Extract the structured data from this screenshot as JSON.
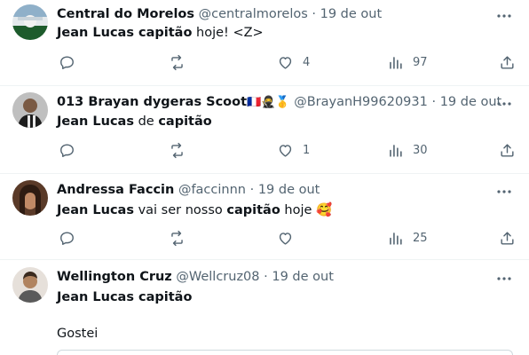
{
  "tweets": [
    {
      "name": "Central do Morelos",
      "handle": "@centralmorelos",
      "dot": "·",
      "date": "19 de out",
      "text_parts": [
        {
          "t": "Jean Lucas ",
          "b": true
        },
        {
          "t": "capitão",
          "b": true
        },
        {
          "t": " hoje! <Z>",
          "b": false
        }
      ],
      "counts": {
        "reply": "",
        "retweet": "",
        "like": "4",
        "views": "97"
      },
      "avatar_colors": [
        "#1d5b2c",
        "#d8dde0"
      ]
    },
    {
      "name": "013 Brayan dygeras Scoot",
      "name_emojis": "🇫🇷🥷🥇",
      "handle": "@BrayanH99620931",
      "dot": "·",
      "date": "19 de out",
      "text_parts": [
        {
          "t": "Jean Lucas",
          "b": true
        },
        {
          "t": " de ",
          "b": false
        },
        {
          "t": "capitão",
          "b": true
        }
      ],
      "counts": {
        "reply": "",
        "retweet": "",
        "like": "1",
        "views": "30"
      },
      "avatar_colors": [
        "#2a2a2a",
        "#c9c9c9"
      ]
    },
    {
      "name": "Andressa Faccin",
      "handle": "@faccinnn",
      "dot": "·",
      "date": "19 de out",
      "text_parts": [
        {
          "t": "Jean Lucas",
          "b": true
        },
        {
          "t": " vai ser nosso ",
          "b": false
        },
        {
          "t": "capitão",
          "b": true
        },
        {
          "t": " hoje ",
          "b": false
        },
        {
          "t": "🥰",
          "b": false
        }
      ],
      "counts": {
        "reply": "",
        "retweet": "",
        "like": "",
        "views": "25"
      },
      "avatar_colors": [
        "#7a4a2e",
        "#3a2a20"
      ]
    },
    {
      "name": "Wellington Cruz",
      "handle": "@Wellcruz08",
      "dot": "·",
      "date": "19 de out",
      "text_parts": [
        {
          "t": "Jean Lucas capitão",
          "b": true
        }
      ],
      "avatar_colors": [
        "#a57a5a",
        "#e8e2dc"
      ]
    }
  ],
  "reply_text": "Gostei",
  "colors": {
    "muted": "#536471",
    "text": "#0f1419",
    "divider": "#eff3f4"
  }
}
